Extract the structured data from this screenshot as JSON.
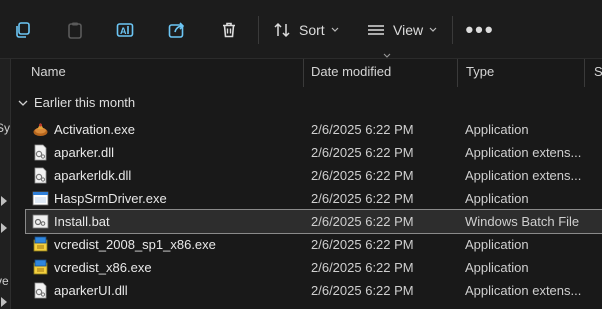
{
  "toolbar": {
    "sort_label": "Sort",
    "view_label": "View",
    "more_label": "•••"
  },
  "columns": {
    "name": "Name",
    "date": "Date modified",
    "type": "Type",
    "size": "S"
  },
  "left_pane_fragments": [
    "Sy",
    "ve"
  ],
  "group_label": "Earlier this month",
  "files": [
    {
      "name": "Activation.exe",
      "date": "2/6/2025 6:22 PM",
      "type": "Application",
      "icon": "activation-app-icon"
    },
    {
      "name": "aparker.dll",
      "date": "2/6/2025 6:22 PM",
      "type": "Application extens...",
      "icon": "dll-file-icon"
    },
    {
      "name": "aparkerldk.dll",
      "date": "2/6/2025 6:22 PM",
      "type": "Application extens...",
      "icon": "dll-file-icon"
    },
    {
      "name": "HaspSrmDriver.exe",
      "date": "2/6/2025 6:22 PM",
      "type": "Application",
      "icon": "window-app-icon"
    },
    {
      "name": "Install.bat",
      "date": "2/6/2025 6:22 PM",
      "type": "Windows Batch File",
      "icon": "batch-file-icon"
    },
    {
      "name": "vcredist_2008_sp1_x86.exe",
      "date": "2/6/2025 6:22 PM",
      "type": "Application",
      "icon": "installer-icon"
    },
    {
      "name": "vcredist_x86.exe",
      "date": "2/6/2025 6:22 PM",
      "type": "Application",
      "icon": "installer-icon"
    },
    {
      "name": "aparkerUI.dll",
      "date": "2/6/2025 6:22 PM",
      "type": "Application extens...",
      "icon": "dll-file-icon"
    }
  ],
  "colors": {
    "background": "#191919",
    "selected_row": "#2d2d2d",
    "accent_icon": "#6cc6f5"
  }
}
